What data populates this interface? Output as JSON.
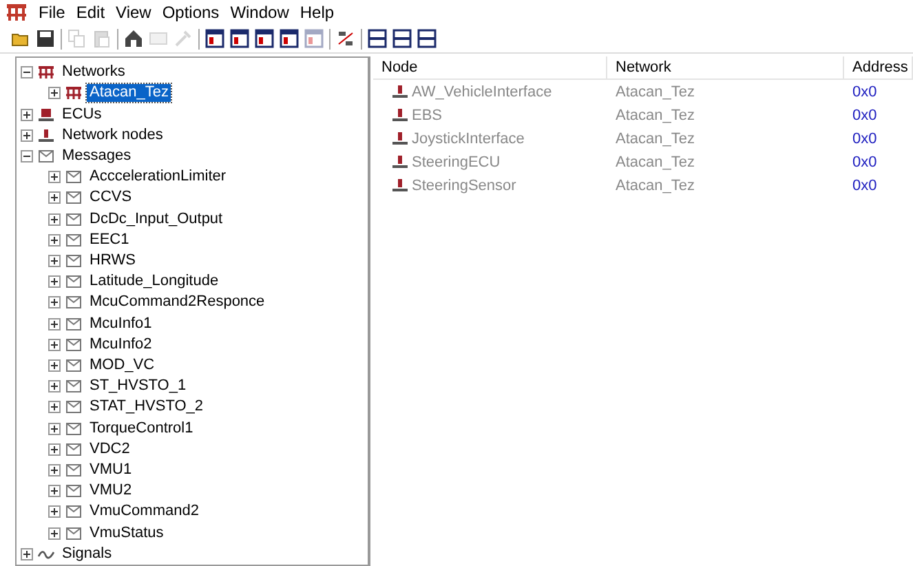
{
  "menu": [
    "File",
    "Edit",
    "View",
    "Options",
    "Window",
    "Help"
  ],
  "toolbar": [
    {
      "kind": "open",
      "disabled": false
    },
    {
      "kind": "save",
      "disabled": false
    },
    {
      "kind": "sep"
    },
    {
      "kind": "copy",
      "disabled": true
    },
    {
      "kind": "paste",
      "disabled": true
    },
    {
      "kind": "sep"
    },
    {
      "kind": "home",
      "disabled": false
    },
    {
      "kind": "card",
      "disabled": true
    },
    {
      "kind": "tool",
      "disabled": true
    },
    {
      "kind": "sep"
    },
    {
      "kind": "win",
      "disabled": false
    },
    {
      "kind": "win",
      "disabled": false
    },
    {
      "kind": "win",
      "disabled": false
    },
    {
      "kind": "win",
      "disabled": false
    },
    {
      "kind": "win",
      "disabled": true
    },
    {
      "kind": "sep"
    },
    {
      "kind": "dechex",
      "disabled": false
    },
    {
      "kind": "sep"
    },
    {
      "kind": "tile",
      "disabled": false
    },
    {
      "kind": "tile",
      "disabled": false
    },
    {
      "kind": "tile",
      "disabled": false
    }
  ],
  "tree": [
    {
      "label": "Networks",
      "kind": "network",
      "expanded": true,
      "selected": false,
      "children": [
        {
          "label": "Atacan_Tez",
          "kind": "network",
          "expanded": false,
          "selected": true
        }
      ]
    },
    {
      "label": "ECUs",
      "kind": "ecu",
      "expanded": false,
      "selected": false
    },
    {
      "label": "Network nodes",
      "kind": "node",
      "expanded": false,
      "selected": false
    },
    {
      "label": "Messages",
      "kind": "message",
      "expanded": true,
      "selected": false,
      "children": [
        {
          "label": "AcccelerationLimiter",
          "kind": "message",
          "expanded": false,
          "selected": false
        },
        {
          "label": "CCVS",
          "kind": "message",
          "expanded": false,
          "selected": false
        },
        {
          "label": "DcDc_Input_Output",
          "kind": "message",
          "expanded": false,
          "selected": false
        },
        {
          "label": "EEC1",
          "kind": "message",
          "expanded": false,
          "selected": false
        },
        {
          "label": "HRWS",
          "kind": "message",
          "expanded": false,
          "selected": false
        },
        {
          "label": "Latitude_Longitude",
          "kind": "message",
          "expanded": false,
          "selected": false
        },
        {
          "label": "McuCommand2Responce",
          "kind": "message",
          "expanded": false,
          "selected": false
        },
        {
          "label": "McuInfo1",
          "kind": "message",
          "expanded": false,
          "selected": false
        },
        {
          "label": "McuInfo2",
          "kind": "message",
          "expanded": false,
          "selected": false
        },
        {
          "label": "MOD_VC",
          "kind": "message",
          "expanded": false,
          "selected": false
        },
        {
          "label": "ST_HVSTO_1",
          "kind": "message",
          "expanded": false,
          "selected": false
        },
        {
          "label": "STAT_HVSTO_2",
          "kind": "message",
          "expanded": false,
          "selected": false
        },
        {
          "label": "TorqueControl1",
          "kind": "message",
          "expanded": false,
          "selected": false
        },
        {
          "label": "VDC2",
          "kind": "message",
          "expanded": false,
          "selected": false
        },
        {
          "label": "VMU1",
          "kind": "message",
          "expanded": false,
          "selected": false
        },
        {
          "label": "VMU2",
          "kind": "message",
          "expanded": false,
          "selected": false
        },
        {
          "label": "VmuCommand2",
          "kind": "message",
          "expanded": false,
          "selected": false
        },
        {
          "label": "VmuStatus",
          "kind": "message",
          "expanded": false,
          "selected": false
        }
      ]
    },
    {
      "label": "Signals",
      "kind": "signal",
      "expanded": false,
      "selected": false
    }
  ],
  "table": {
    "columns": [
      "Node",
      "Network",
      "Address"
    ],
    "rows": [
      [
        "AW_VehicleInterface",
        "Atacan_Tez",
        "0x0"
      ],
      [
        "EBS",
        "Atacan_Tez",
        "0x0"
      ],
      [
        "JoystickInterface",
        "Atacan_Tez",
        "0x0"
      ],
      [
        "SteeringECU",
        "Atacan_Tez",
        "0x0"
      ],
      [
        "SteeringSensor",
        "Atacan_Tez",
        "0x0"
      ]
    ]
  }
}
